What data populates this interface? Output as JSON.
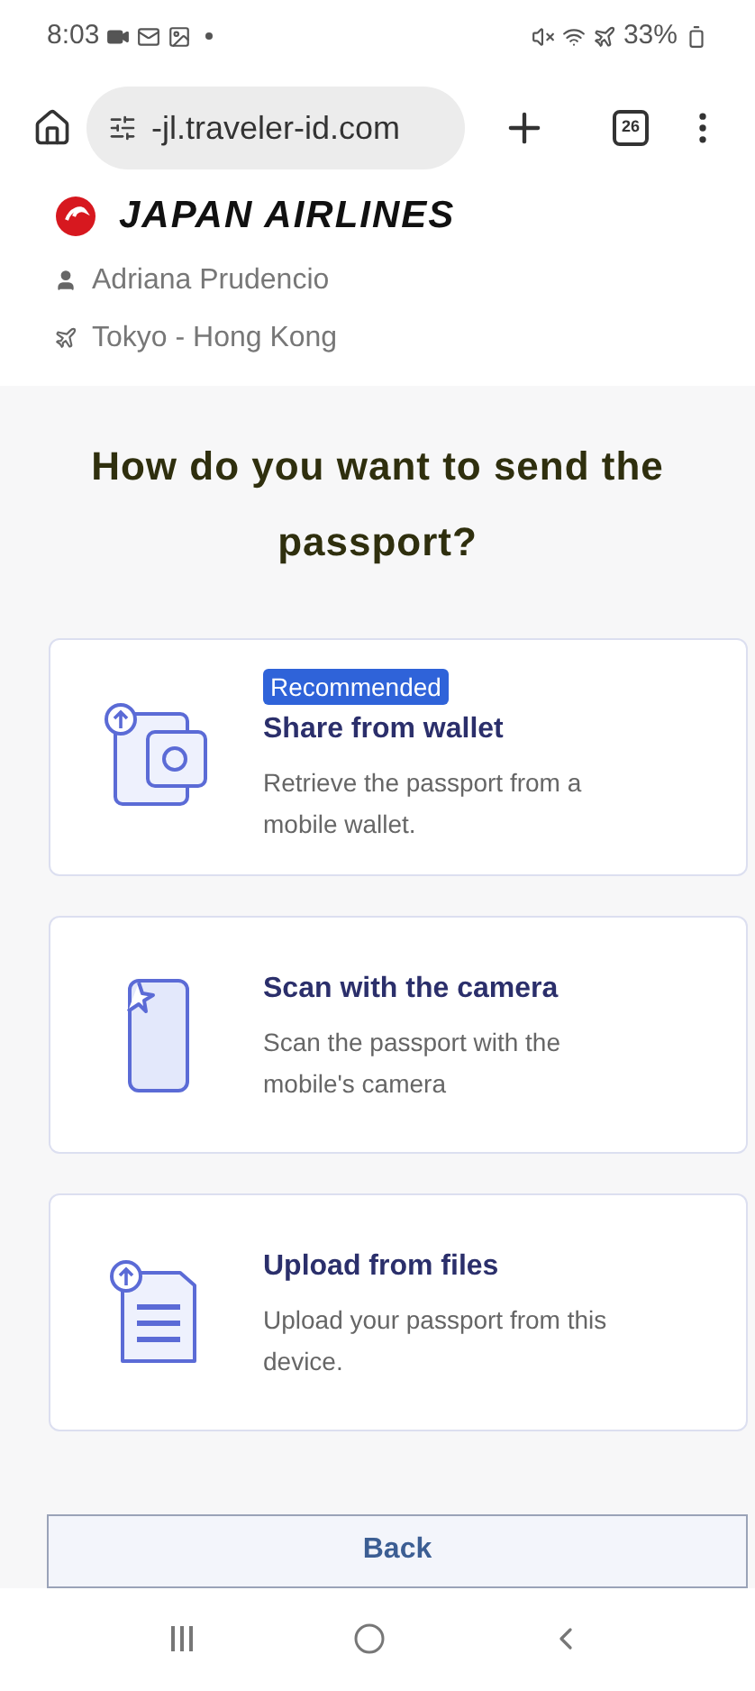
{
  "status_bar": {
    "time": "8:03",
    "battery": "33%"
  },
  "browser": {
    "url": "-jl.traveler-id.com",
    "tab_count": "26"
  },
  "header": {
    "airline": "JAPAN AIRLINES",
    "passenger": "Adriana Prudencio",
    "route": "Tokyo - Hong Kong"
  },
  "title": "How do you want to send the passport?",
  "options": [
    {
      "kind": "wallet",
      "badge": "Recommended",
      "title": "Share from wallet",
      "description": "Retrieve the passport from a mobile wallet."
    },
    {
      "kind": "camera",
      "title": "Scan with the camera",
      "description": "Scan the passport with the mobile's camera"
    },
    {
      "kind": "files",
      "title": "Upload from files",
      "description": "Upload your passport from this device."
    }
  ],
  "back_button": "Back"
}
